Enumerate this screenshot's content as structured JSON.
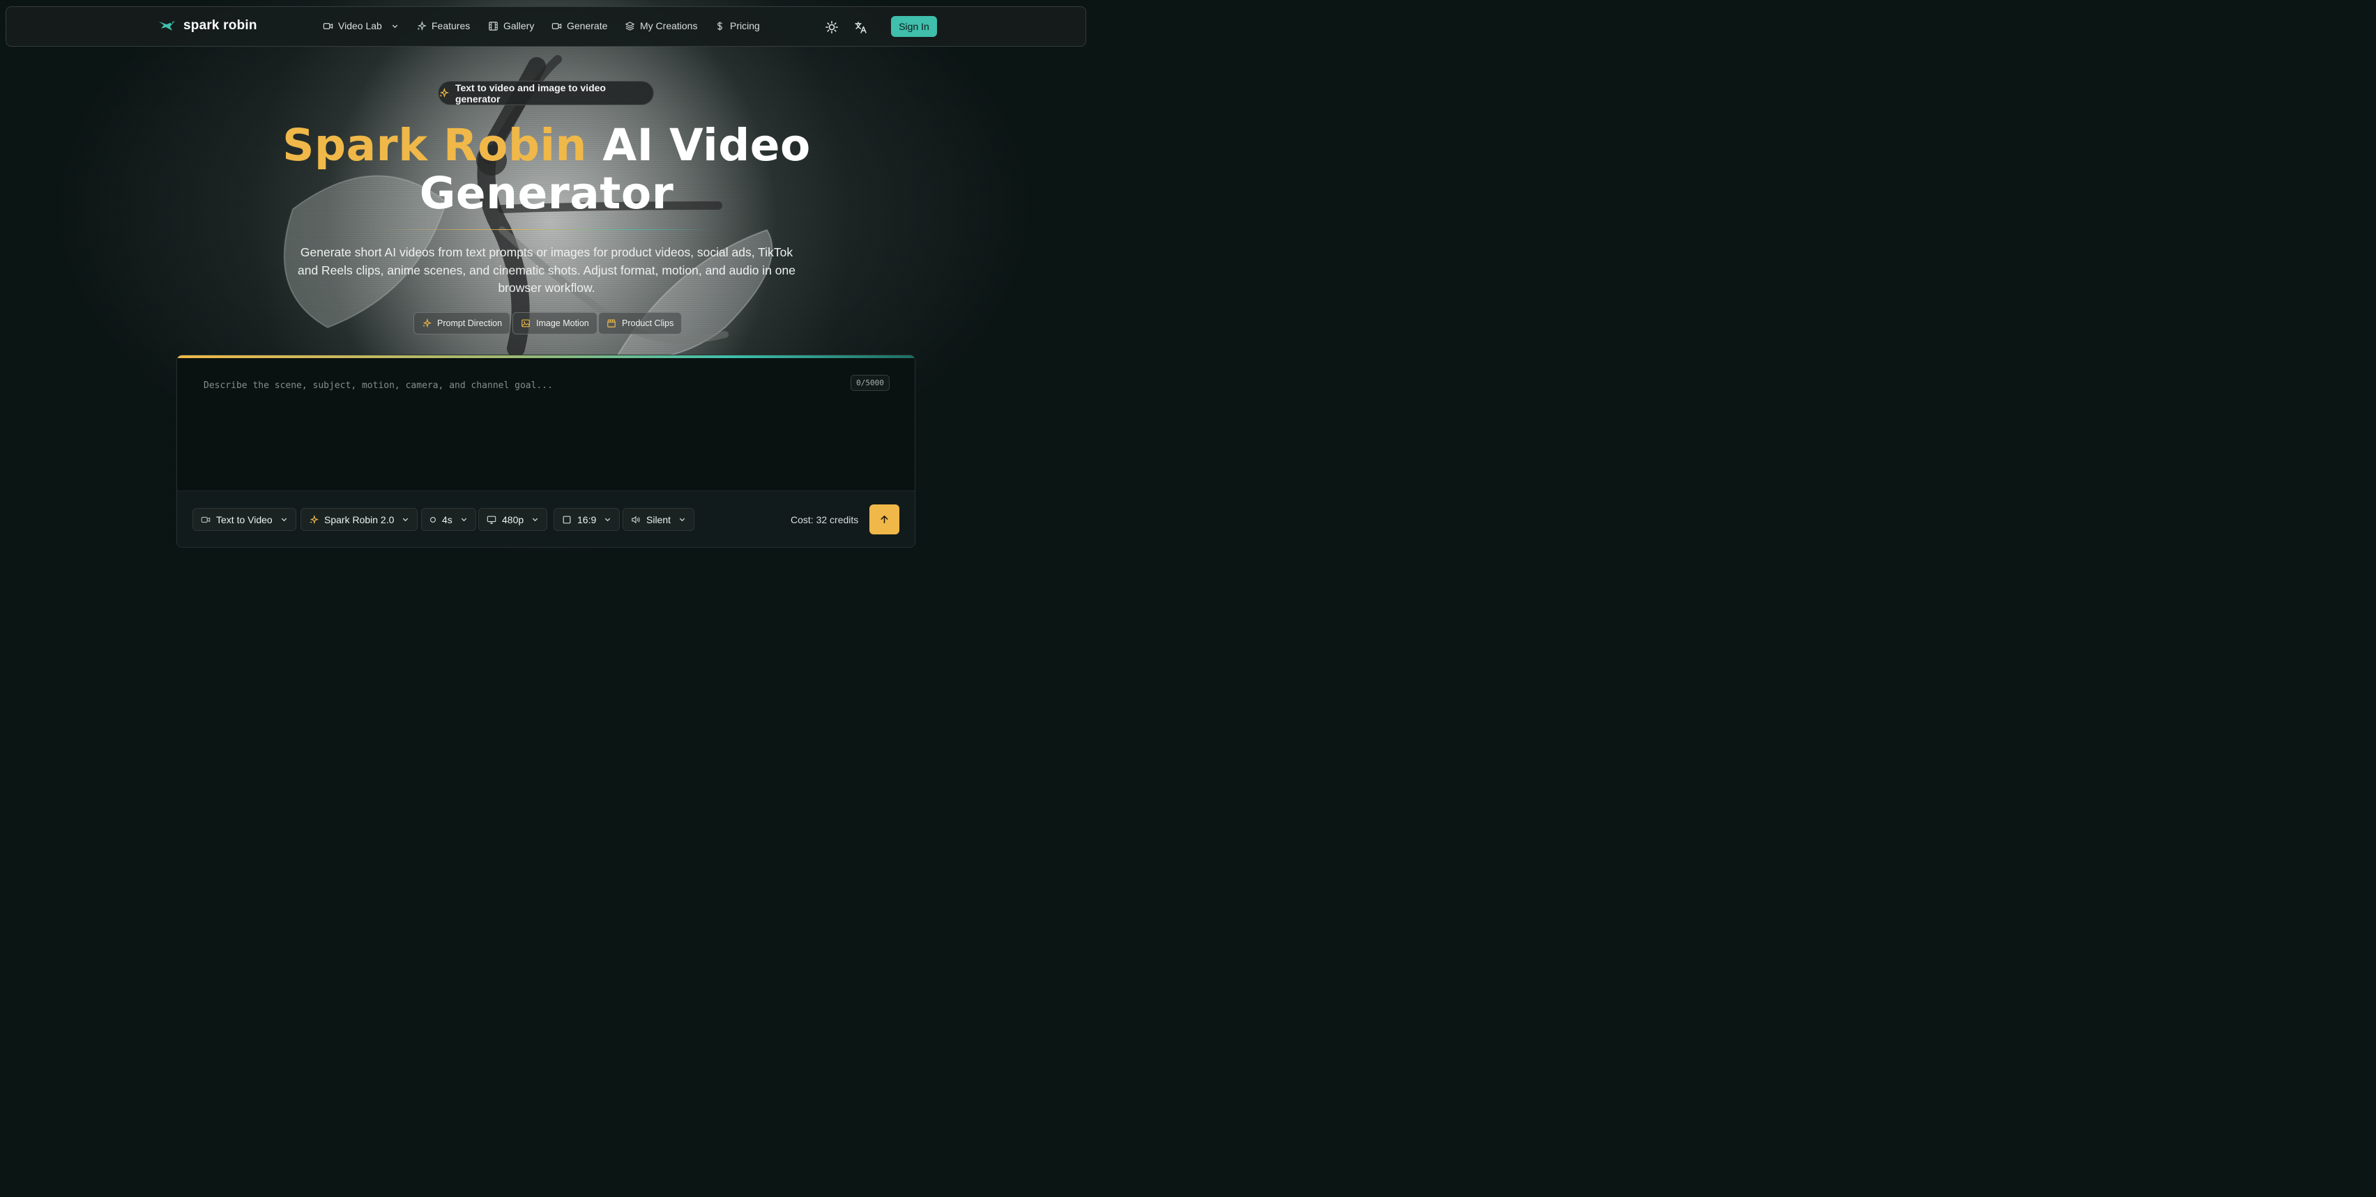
{
  "brand": {
    "name": "spark robin",
    "accent": "#f0b849",
    "teal": "#3fbfac"
  },
  "nav": {
    "items": [
      {
        "label": "Video Lab",
        "icon": "video-icon",
        "has_dropdown": true
      },
      {
        "label": "Features",
        "icon": "sparkles-icon"
      },
      {
        "label": "Gallery",
        "icon": "film-icon"
      },
      {
        "label": "Generate",
        "icon": "video-icon"
      },
      {
        "label": "My Creations",
        "icon": "layers-icon"
      },
      {
        "label": "Pricing",
        "icon": "dollar-icon"
      }
    ],
    "theme_icon": "sun-icon",
    "language_icon": "translate-icon",
    "sign_in": "Sign In"
  },
  "hero": {
    "badge": "Text to video and image to video generator",
    "title_accent": "Spark Robin",
    "title_rest": "AI Video",
    "title_line2": "Generator",
    "subtitle": "Generate short AI videos from text prompts or images for product videos, social ads, TikTok and Reels clips, anime scenes, and cinematic shots. Adjust format, motion, and audio in one browser workflow.",
    "chips": [
      {
        "label": "Prompt Direction",
        "icon": "sparkles-icon"
      },
      {
        "label": "Image Motion",
        "icon": "image-icon"
      },
      {
        "label": "Product Clips",
        "icon": "clapperboard-icon"
      }
    ]
  },
  "composer": {
    "placeholder": "Describe the scene, subject, motion, camera, and channel goal...",
    "value": "",
    "counter": "0/5000",
    "mode": "Text to Video",
    "model": "Spark Robin 2.0",
    "duration": "4s",
    "resolution": "480p",
    "aspect": "16:9",
    "audio": "Silent",
    "cost": "Cost: 32 credits",
    "submit_icon": "arrow-up-icon"
  }
}
